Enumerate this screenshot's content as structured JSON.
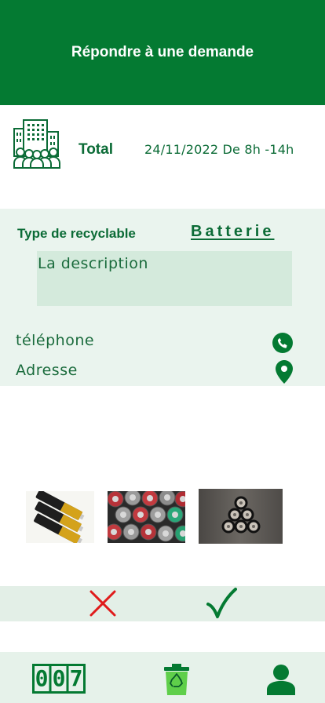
{
  "header": {
    "title": "Répondre à une demande"
  },
  "company": {
    "name": "Total",
    "schedule": "24/11/2022 De 8h -14h",
    "logo_icon": "building-people-icon"
  },
  "request": {
    "type_label": "Type de recyclable",
    "type_value": "Batterie",
    "description_placeholder": "La description",
    "phone_label": "téléphone",
    "address_label": "Adresse"
  },
  "photos": [
    "aa-batteries-photo",
    "battery-tops-photo",
    "battery-pyramid-photo"
  ],
  "actions": {
    "reject_icon": "close-icon",
    "accept_icon": "check-icon"
  },
  "bottom_nav": {
    "counter_digits": [
      "0",
      "0",
      "7"
    ],
    "bin_icon": "recycle-bin-icon",
    "profile_icon": "user-icon"
  },
  "colors": {
    "primary": "#047a32",
    "text": "#0b6b36",
    "panel": "#eaf4ee",
    "reject": "#e01b1b"
  }
}
